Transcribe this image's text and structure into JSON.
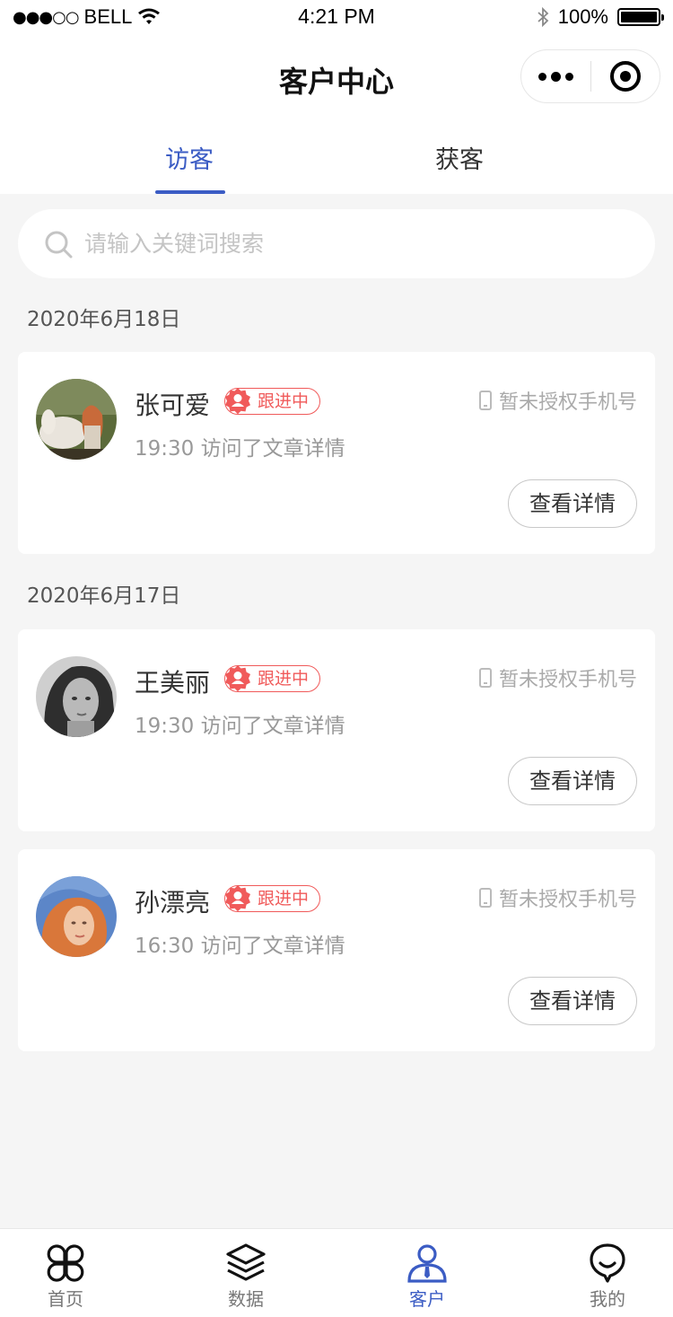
{
  "status_bar": {
    "signal": "●●●○○",
    "carrier": "BELL",
    "time": "4:21 PM",
    "battery": "100%",
    "battery_level": 1.0
  },
  "nav": {
    "title": "客户中心"
  },
  "tabs": [
    {
      "label": "访客",
      "active": true
    },
    {
      "label": "获客",
      "active": false
    }
  ],
  "search": {
    "placeholder": "请输入关键词搜索"
  },
  "groups": [
    {
      "date": "2020年6月18日",
      "customers": [
        {
          "name": "张可爱",
          "tag": "跟进中",
          "activity": "19:30 访问了文章详情",
          "phone": "暂未授权手机号",
          "button": "查看详情"
        }
      ]
    },
    {
      "date": "2020年6月17日",
      "customers": [
        {
          "name": "王美丽",
          "tag": "跟进中",
          "activity": "19:30 访问了文章详情",
          "phone": "暂未授权手机号",
          "button": "查看详情"
        },
        {
          "name": "孙漂亮",
          "tag": "跟进中",
          "activity": "16:30 访问了文章详情",
          "phone": "暂未授权手机号",
          "button": "查看详情"
        }
      ]
    }
  ],
  "tabbar": [
    {
      "label": "首页",
      "icon": "home-grid-icon"
    },
    {
      "label": "数据",
      "icon": "layers-icon"
    },
    {
      "label": "客户",
      "icon": "customer-icon",
      "active": true
    },
    {
      "label": "我的",
      "icon": "profile-icon"
    }
  ],
  "colors": {
    "accent": "#3b5cc4",
    "tag": "#f05a5a",
    "background": "#f5f5f5"
  }
}
